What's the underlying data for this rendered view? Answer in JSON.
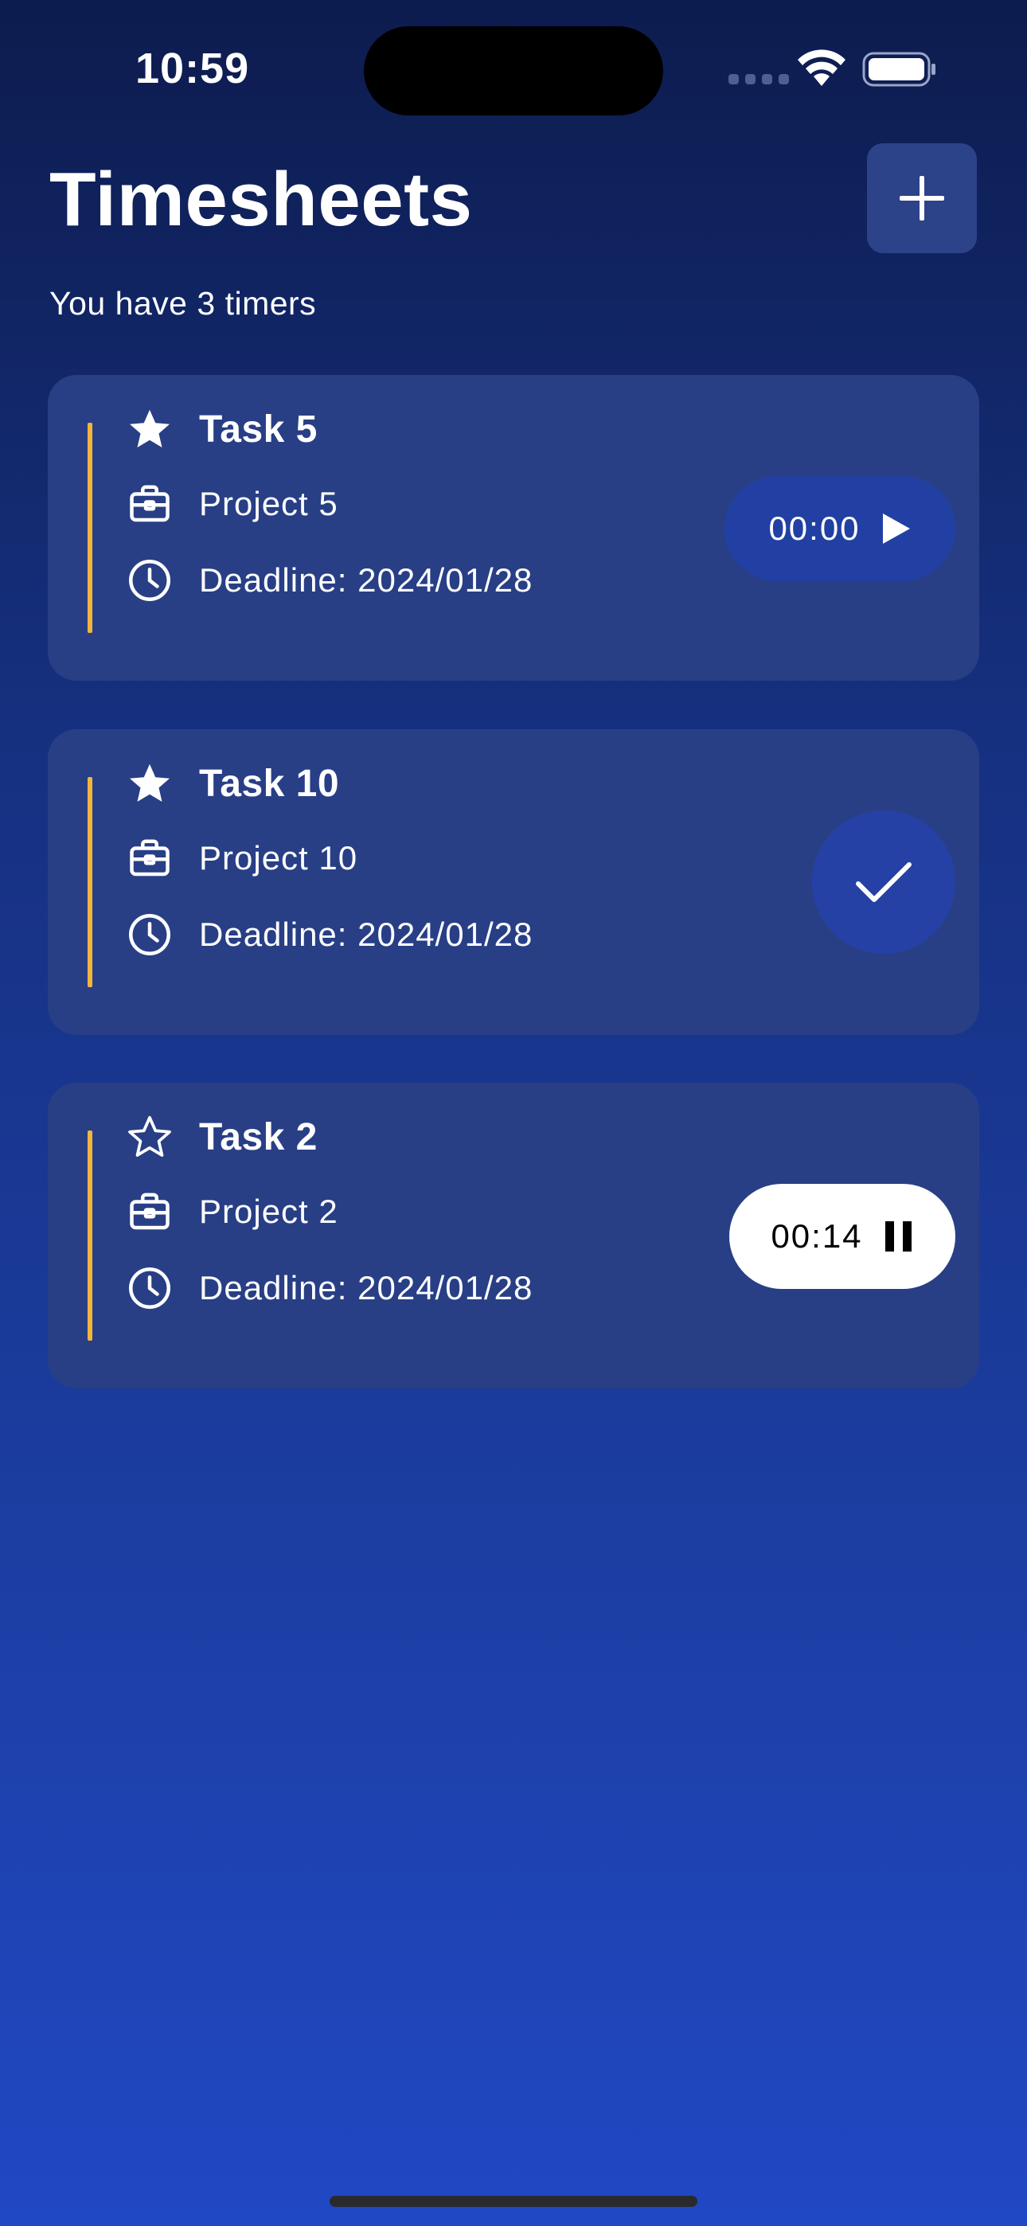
{
  "status_bar": {
    "time": "10:59"
  },
  "header": {
    "title": "Timesheets",
    "subtitle": "You have 3 timers"
  },
  "tasks": [
    {
      "title": "Task 5",
      "project": "Project 5",
      "deadline": "Deadline: 2024/01/28",
      "starred": true,
      "timer": "00:00",
      "state": "stopped"
    },
    {
      "title": "Task 10",
      "project": "Project 10",
      "deadline": "Deadline: 2024/01/28",
      "starred": true,
      "state": "completed"
    },
    {
      "title": "Task 2",
      "project": "Project 2",
      "deadline": "Deadline: 2024/01/28",
      "starred": false,
      "timer": "00:14",
      "state": "running"
    }
  ],
  "colors": {
    "accent": "#f2b63a",
    "card": "#283f86",
    "button": "#2240a3"
  },
  "icons": [
    "star-filled-icon",
    "star-outline-icon",
    "briefcase-icon",
    "clock-icon",
    "play-icon",
    "pause-icon",
    "checkmark-icon",
    "plus-icon"
  ]
}
